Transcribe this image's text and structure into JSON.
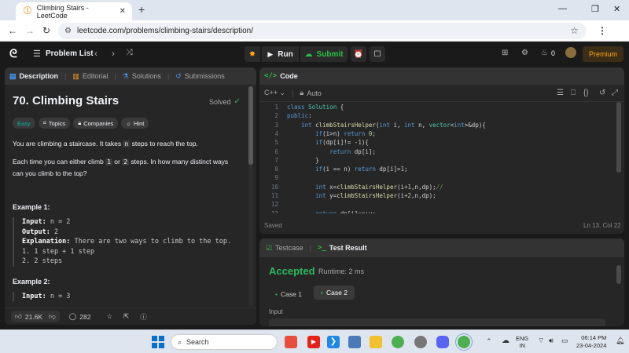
{
  "browser": {
    "tab_title": "Climbing Stairs - LeetCode",
    "url": "leetcode.com/problems/climbing-stairs/description/"
  },
  "nav": {
    "problem_list": "Problem List",
    "run": "Run",
    "submit": "Submit",
    "streak": "0",
    "premium": "Premium"
  },
  "left_tabs": [
    "Description",
    "Editorial",
    "Solutions",
    "Submissions"
  ],
  "problem": {
    "title": "70. Climbing Stairs",
    "status": "Solved",
    "tags": [
      "Easy",
      "Topics",
      "Companies",
      "Hint"
    ],
    "desc1_a": "You are climbing a staircase. It takes ",
    "desc1_code": "n",
    "desc1_b": " steps to reach the top.",
    "desc2_a": "Each time you can either climb ",
    "desc2_c1": "1",
    "desc2_or": " or ",
    "desc2_c2": "2",
    "desc2_b": " steps. In how many distinct ways",
    "desc2_c": "can you climb to the top?",
    "example1_title": "Example 1:",
    "ex1_input_label": "Input:",
    "ex1_input": " n = 2",
    "ex1_output_label": "Output:",
    "ex1_output": " 2",
    "ex1_expl_label": "Explanation:",
    "ex1_expl": " There are two ways to climb to the top.",
    "ex1_l1": "1. 1 step + 1 step",
    "ex1_l2": "2. 2 steps",
    "example2_title": "Example 2:",
    "ex2_input_label": "Input:",
    "ex2_input": " n = 3"
  },
  "footer": {
    "likes": "21.6K",
    "comments": "282"
  },
  "code": {
    "header": "Code",
    "language": "C++",
    "mode": "Auto",
    "saved": "Saved",
    "position": "Ln 13, Col 22",
    "line_numbers": [
      "1",
      "2",
      "3",
      "4",
      "5",
      "6",
      "7",
      "8",
      "9",
      "10",
      "11",
      "12",
      "13"
    ]
  },
  "result": {
    "tab_testcase": "Testcase",
    "tab_result": "Test Result",
    "verdict": "Accepted",
    "runtime": "Runtime: 2 ms",
    "case1": "Case 1",
    "case2": "Case 2",
    "input_label": "Input"
  },
  "taskbar": {
    "search": "Search",
    "lang1": "ENG",
    "lang2": "IN",
    "time": "06:14 PM",
    "date": "23-04-2024"
  },
  "colors": {
    "accepted": "#2cbb5d",
    "submit": "#28c244",
    "premium": "#ffa116",
    "easy": "#00b8a3"
  }
}
